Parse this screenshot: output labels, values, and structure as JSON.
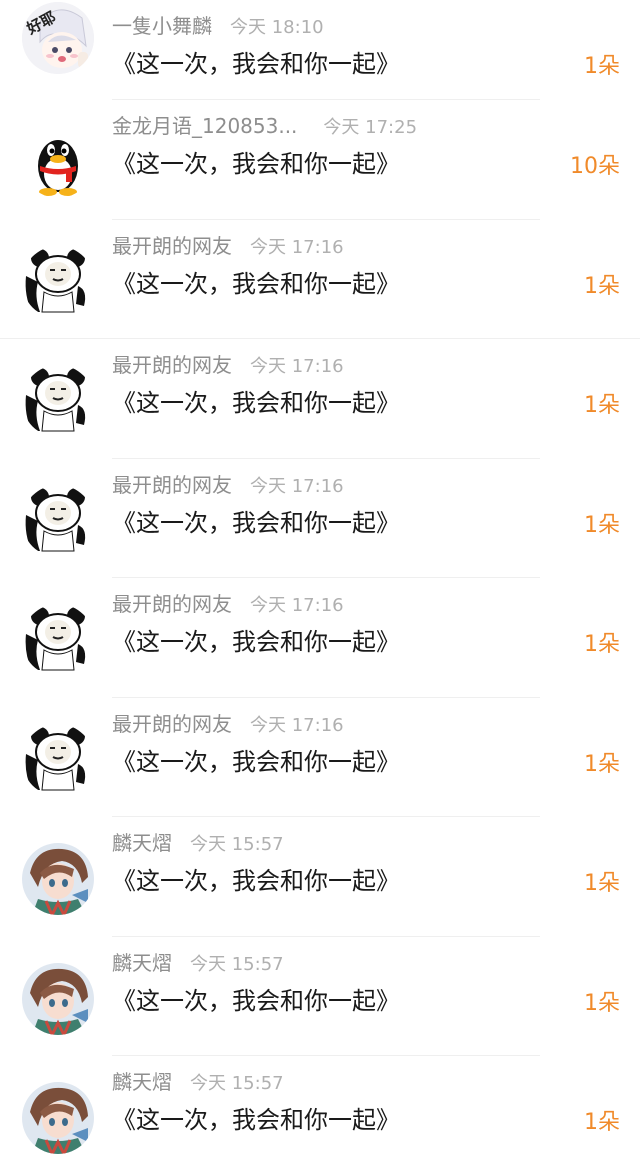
{
  "accent_color": "#f08a2a",
  "comments": [
    {
      "name": "一隻小舞麟",
      "time": "今天 18:10",
      "message": "《这一次，我会和你一起》",
      "count": "1朵",
      "avatar": "anime-girl-avatar",
      "avatar_text": "好耶"
    },
    {
      "name": "金龙月语_120853...",
      "time": "今天 17:25",
      "message": "《这一次，我会和你一起》",
      "count": "10朵",
      "avatar": "qq-penguin-avatar"
    },
    {
      "name": "最开朗的网友",
      "time": "今天 17:16",
      "message": "《这一次，我会和你一起》",
      "count": "1朵",
      "avatar": "panda-meme-avatar"
    },
    {
      "name": "最开朗的网友",
      "time": "今天 17:16",
      "message": "《这一次，我会和你一起》",
      "count": "1朵",
      "avatar": "panda-meme-avatar"
    },
    {
      "name": "最开朗的网友",
      "time": "今天 17:16",
      "message": "《这一次，我会和你一起》",
      "count": "1朵",
      "avatar": "panda-meme-avatar"
    },
    {
      "name": "最开朗的网友",
      "time": "今天 17:16",
      "message": "《这一次，我会和你一起》",
      "count": "1朵",
      "avatar": "panda-meme-avatar"
    },
    {
      "name": "最开朗的网友",
      "time": "今天 17:16",
      "message": "《这一次，我会和你一起》",
      "count": "1朵",
      "avatar": "panda-meme-avatar"
    },
    {
      "name": "麟天熠",
      "time": "今天 15:57",
      "message": "《这一次，我会和你一起》",
      "count": "1朵",
      "avatar": "anime-boy-avatar"
    },
    {
      "name": "麟天熠",
      "time": "今天 15:57",
      "message": "《这一次，我会和你一起》",
      "count": "1朵",
      "avatar": "anime-boy-avatar"
    },
    {
      "name": "麟天熠",
      "time": "今天 15:57",
      "message": "《这一次，我会和你一起》",
      "count": "1朵",
      "avatar": "anime-boy-avatar"
    }
  ]
}
